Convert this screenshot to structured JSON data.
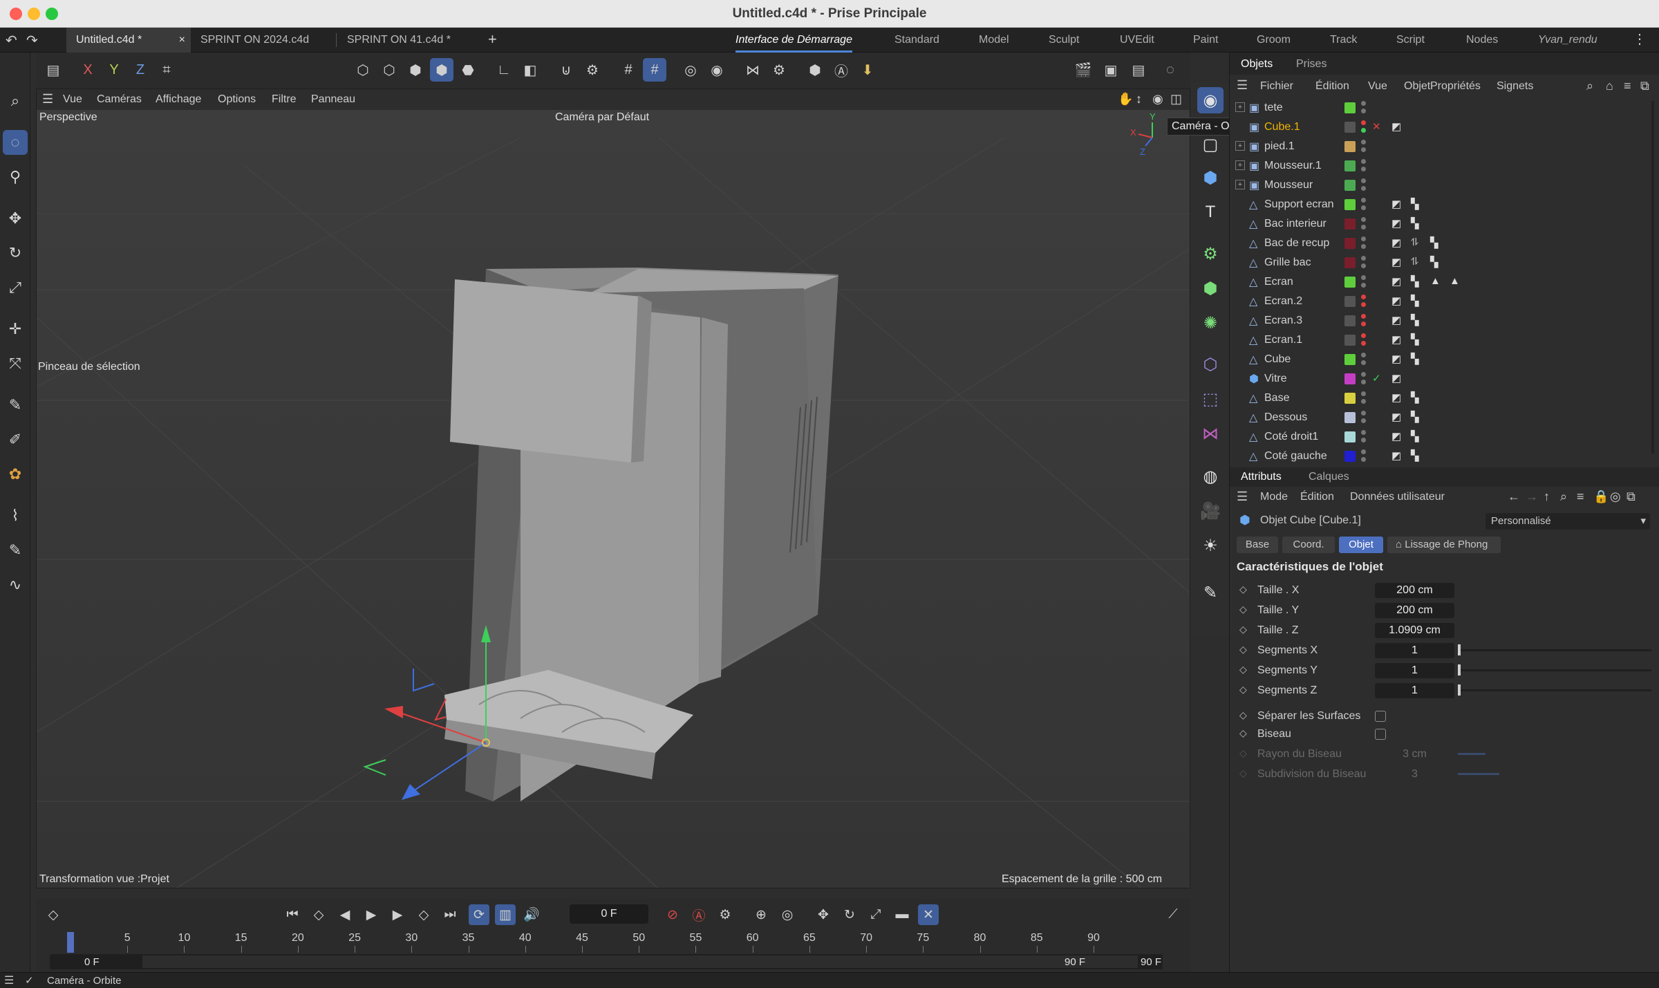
{
  "window": {
    "title": "Untitled.c4d * - Prise Principale"
  },
  "file_tabs": [
    {
      "label": "Untitled.c4d *"
    },
    {
      "label": "SPRINT ON 2024.c4d"
    },
    {
      "label": "SPRINT ON 41.c4d *"
    }
  ],
  "layout_tabs": [
    "Interface de Démarrage",
    "Standard",
    "Model",
    "Sculpt",
    "UVEdit",
    "Paint",
    "Groom",
    "Track",
    "Script",
    "Nodes",
    "Yvan_rendu"
  ],
  "axis_toggles": [
    "X",
    "Y",
    "Z"
  ],
  "viewport": {
    "menu": [
      "Vue",
      "Caméras",
      "Affichage",
      "Options",
      "Filtre",
      "Panneau"
    ],
    "projection": "Perspective",
    "camera": "Caméra par Défaut",
    "tool_hint": "Pinceau de sélection",
    "transform_info": "Transformation vue :Projet",
    "grid_info": "Espacement de la grille : 500 cm"
  },
  "tooltip": "Caméra - Orbite",
  "objects_panel": {
    "tabs": [
      "Objets",
      "Prises"
    ],
    "menu": [
      "Fichier",
      "Édition",
      "Vue",
      "Objet",
      "Propriétés",
      "Signets"
    ],
    "items": [
      {
        "name": "tete",
        "color": "#5fce3c"
      },
      {
        "name": "Cube.1",
        "color": "#555555"
      },
      {
        "name": "pied.1",
        "color": "#c8a058"
      },
      {
        "name": "Mousseur.1",
        "color": "#4caa52"
      },
      {
        "name": "Mousseur",
        "color": "#4caa52"
      },
      {
        "name": "Support ecran",
        "color": "#5fce3c"
      },
      {
        "name": "Bac interieur",
        "color": "#7a1e2c"
      },
      {
        "name": "Bac de recup",
        "color": "#7a1e2c"
      },
      {
        "name": "Grille bac",
        "color": "#7a1e2c"
      },
      {
        "name": "Ecran",
        "color": "#5fce3c"
      },
      {
        "name": "Ecran.2",
        "color": "#555555"
      },
      {
        "name": "Ecran.3",
        "color": "#555555"
      },
      {
        "name": "Ecran.1",
        "color": "#555555"
      },
      {
        "name": "Cube",
        "color": "#5fce3c"
      },
      {
        "name": "Vitre",
        "color": "#c43ec4"
      },
      {
        "name": "Base",
        "color": "#d8d040"
      },
      {
        "name": "Dessous",
        "color": "#b8c0d8"
      },
      {
        "name": "Coté droit1",
        "color": "#a8d8d8"
      },
      {
        "name": "Coté gauche",
        "color": "#2020d0"
      }
    ]
  },
  "attributes_panel": {
    "tabs": [
      "Attributs",
      "Calques"
    ],
    "menu": [
      "Mode",
      "Édition",
      "Données utilisateur"
    ],
    "object_title": "Objet Cube [Cube.1]",
    "preset": "Personnalisé",
    "subtabs": [
      "Base",
      "Coord.",
      "Objet",
      "Lissage de Phong"
    ],
    "section": "Caractéristiques de l'objet",
    "props": [
      {
        "label": "Taille . X",
        "value": "200 cm"
      },
      {
        "label": "Taille . Y",
        "value": "200 cm"
      },
      {
        "label": "Taille . Z",
        "value": "1.0909 cm"
      },
      {
        "label": "Segments X",
        "value": "1"
      },
      {
        "label": "Segments Y",
        "value": "1"
      },
      {
        "label": "Segments Z",
        "value": "1"
      }
    ],
    "checks": [
      {
        "label": "Séparer les Surfaces"
      },
      {
        "label": "Biseau"
      }
    ],
    "disabled_props": [
      {
        "label": "Rayon du Biseau",
        "value": "3 cm"
      },
      {
        "label": "Subdivision du Biseau",
        "value": "3"
      }
    ]
  },
  "timeline": {
    "current_frame": "0 F",
    "ticks": [
      "0",
      "5",
      "10",
      "15",
      "20",
      "25",
      "30",
      "35",
      "40",
      "45",
      "50",
      "55",
      "60",
      "65",
      "70",
      "75",
      "80",
      "85",
      "90"
    ],
    "range": {
      "start_a": "0 F",
      "start_b": "0 F",
      "end_a": "90 F",
      "end_b": "90 F"
    }
  },
  "status": {
    "text": "Caméra - Orbite"
  },
  "colors": {
    "accent": "#3f5e9a",
    "selected_object": "#f0b400",
    "tab_underline": "#4d86d8"
  }
}
